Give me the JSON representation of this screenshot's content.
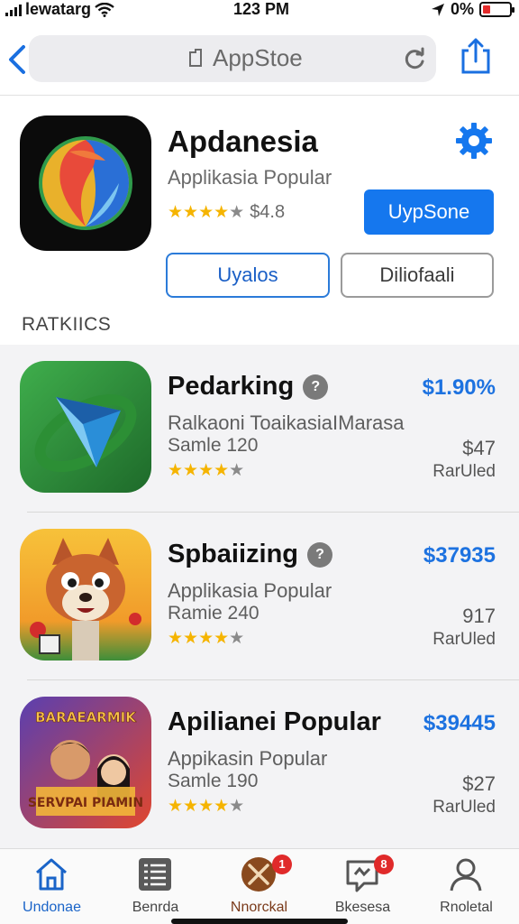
{
  "status_bar": {
    "carrier": "lewatarg",
    "time": "123 PM",
    "battery_text": "0%"
  },
  "browser": {
    "url": "AppStoe"
  },
  "featured": {
    "title": "Apdanesia",
    "subtitle": "Applikasia Popular",
    "rating_stars": 4,
    "price": "$4.8",
    "primary_button": "UypSone",
    "button_left": "Uyalos",
    "button_right": "Diliofaali",
    "colors": {
      "primary": "#1577ee",
      "star": "#f5b400"
    }
  },
  "section": {
    "title": "RATKIICS"
  },
  "apps": [
    {
      "name": "Pedarking",
      "info_icon": "info-icon",
      "description": "Ralkaoni ToaikasiaIMarasa",
      "sample": "Samle 120",
      "rating_stars": 4,
      "price": "$1.90%",
      "small_price": "$47",
      "state": "RarUled"
    },
    {
      "name": "Spbaiizing",
      "info_icon": "info-icon",
      "description": "Applikasia Popular",
      "sample": "Ramie 240",
      "rating_stars": 4,
      "price": "$37935",
      "small_price": "917",
      "state": "RarUled"
    },
    {
      "name": "Apilianei Popular",
      "info_icon": null,
      "description": "Appikasin Popular",
      "sample": "Samle 190",
      "rating_stars": 4,
      "price": "$39445",
      "small_price": "$27",
      "state": "RarUled",
      "icon_text_top": "BARAEARMIK",
      "icon_text_bottom": "SERVPAI PIAMIN"
    }
  ],
  "tabbar": {
    "tabs": [
      {
        "label": "Undonae",
        "icon": "home-icon"
      },
      {
        "label": "Benrda",
        "icon": "list-icon"
      },
      {
        "label": "Nnorckal",
        "icon": "compass-icon",
        "badge": "1"
      },
      {
        "label": "Bkesesa",
        "icon": "message-icon",
        "badge": "8"
      },
      {
        "label": "Rnoletal",
        "icon": "person-icon"
      }
    ]
  }
}
